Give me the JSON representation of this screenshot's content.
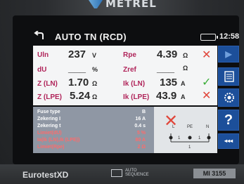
{
  "brand": "METREL",
  "header": {
    "title": "AUTO TN (RCD)",
    "time": "12:58"
  },
  "results": {
    "uln": {
      "label": "Uln",
      "value": "237",
      "unit": "V"
    },
    "rpe": {
      "label": "Rpe",
      "value": "4.39",
      "unit": "Ω",
      "status": "fail"
    },
    "du": {
      "label": "dU",
      "value": "___",
      "unit": "%"
    },
    "zref": {
      "label": "Zref",
      "value": "___",
      "unit": "Ω"
    },
    "zln": {
      "label": "Z (LN)",
      "value": "1.70",
      "unit": "Ω"
    },
    "ikln": {
      "label": "Ik (LN)",
      "value": "135",
      "unit": "A",
      "status": "pass"
    },
    "zlpe": {
      "label": "Z (LPE)",
      "value": "5.24",
      "unit": "Ω"
    },
    "iklpe": {
      "label": "Ik (LPE)",
      "value": "43.9",
      "unit": "A",
      "status": "fail"
    }
  },
  "info": {
    "rows": [
      {
        "label": "Fuse type",
        "value": "B",
        "highlight": false
      },
      {
        "label": "Zekering I",
        "value": "16 A",
        "highlight": false
      },
      {
        "label": "Zekering t",
        "value": "0.4 s",
        "highlight": false
      },
      {
        "label": "Limiet(dU)",
        "value": "5 %",
        "highlight": true
      },
      {
        "label": "Ia(Ik (LN),Ik (LPE))",
        "value": "80 A",
        "highlight": true
      },
      {
        "label": "Limiet(Rpe)",
        "value": "2 Ω",
        "highlight": true
      }
    ],
    "diagram_labels": {
      "l": "L",
      "pe": "PE",
      "n": "N",
      "one": "1",
      "one_b": "1",
      "one_c": "1"
    }
  },
  "footer": {
    "model": "EurotestXD",
    "auto_sequence_line1": "AUTO",
    "auto_sequence_line2": "SEQUENCE",
    "model_number": "MI 3155"
  },
  "colors": {
    "label": "#b0245a",
    "fail": "#e0463b",
    "pass": "#3cae3a",
    "button": "#1c4f9a"
  }
}
